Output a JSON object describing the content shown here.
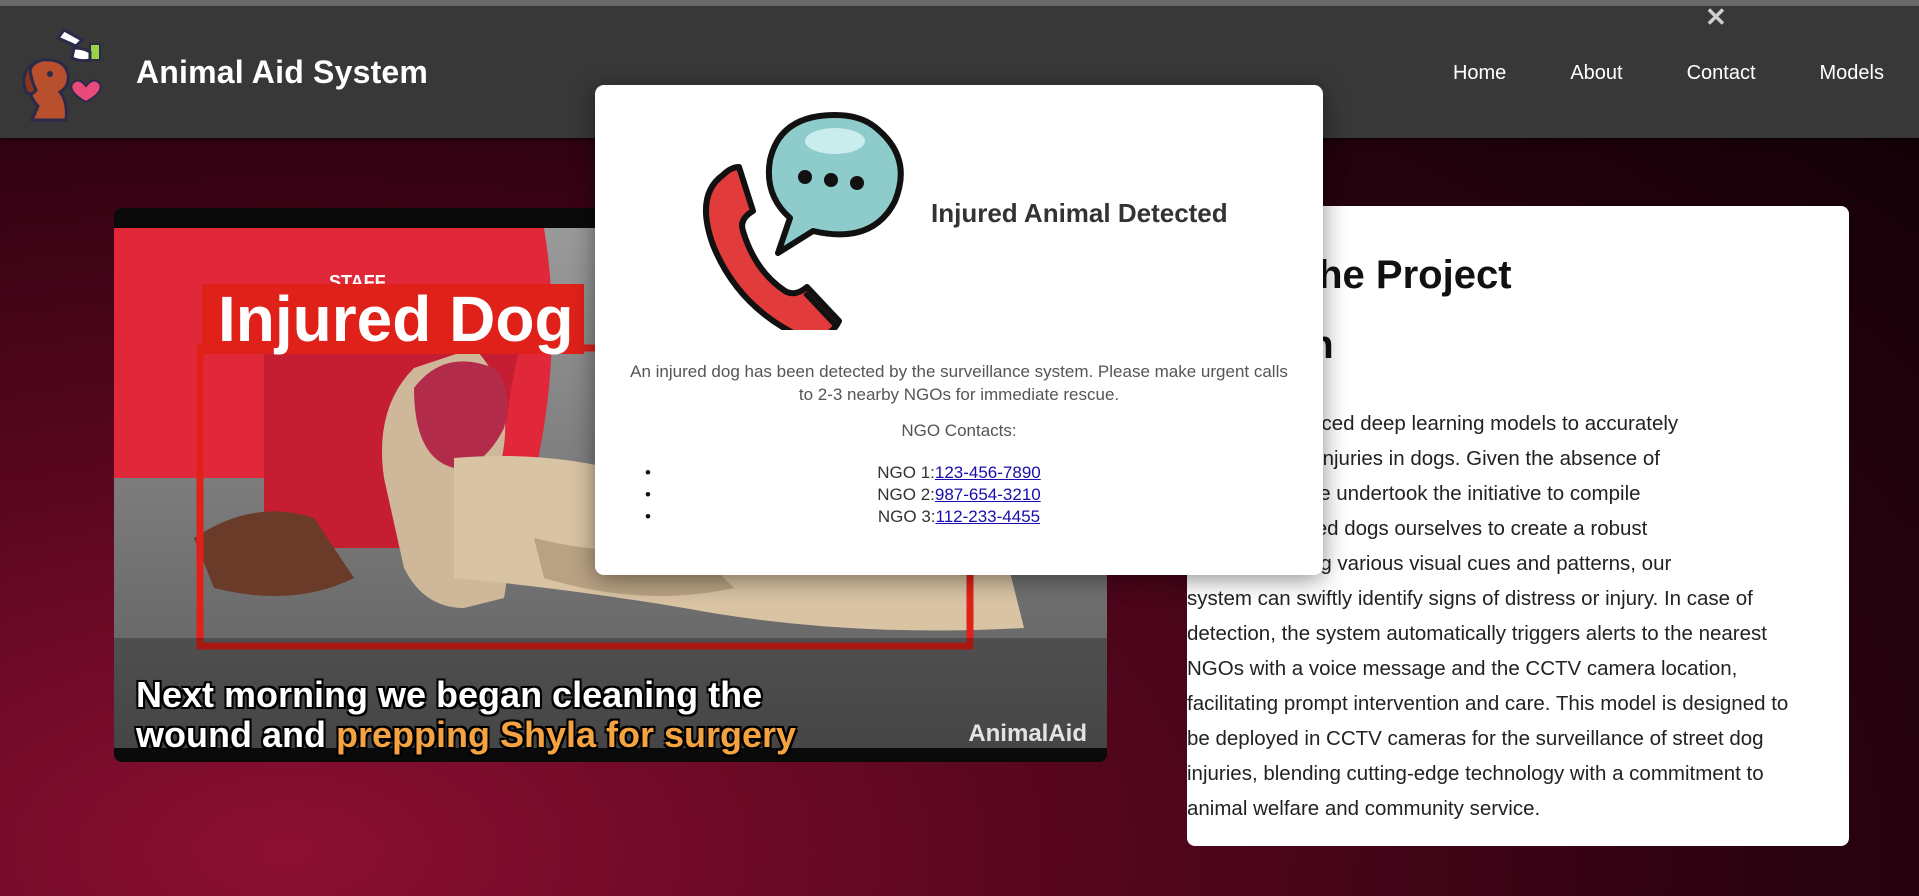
{
  "app": {
    "brand": "Animal Aid System",
    "logo_icon": "dog-care-logo-icon"
  },
  "nav": {
    "items": [
      "Home",
      "About",
      "Contact",
      "Models"
    ]
  },
  "close_label": "✕",
  "video": {
    "detection_label": "Injured Dog",
    "caption_line1": "Next morning we began cleaning the",
    "caption_line2_plain": "wound and ",
    "caption_line2_highlight": "prepping Shyla for surgery",
    "watermark": "AnimalAid",
    "shirt_text": "STAFF"
  },
  "info_card": {
    "title_line1": "me to the Project",
    "title_line2": "stration",
    "body_lines": [
      "verages advanced deep learning models to accurately",
      "sess potential injuries in dogs. Given the absence of",
      "ng datasets, we undertook the initiative to compile",
      "mages of injured dogs ourselves to create a robust",
      "et. By analyzing various visual cues and patterns, our",
      "system can swiftly identify signs of distress or injury. In case of",
      "detection, the system automatically triggers alerts to the nearest",
      "NGOs with a voice message and the CCTV camera location,",
      "facilitating prompt intervention and care. This model is designed to",
      "be deployed in CCTV cameras for the surveillance of street dog",
      "injuries, blending cutting-edge technology with a commitment to",
      "animal welfare and community service."
    ]
  },
  "alert_modal": {
    "icon": "phone-chat-icon",
    "title": "Injured Animal Detected",
    "message": "An injured dog has been detected by the surveillance system. Please make urgent calls to 2-3 nearby NGOs for immediate rescue.",
    "contacts_heading": "NGO Contacts:",
    "contacts": [
      {
        "label": "NGO 1:",
        "phone": "123-456-7890"
      },
      {
        "label": "NGO 2:",
        "phone": "987-654-3210"
      },
      {
        "label": "NGO 3:",
        "phone": "112-233-4455"
      }
    ]
  },
  "colors": {
    "header_bg": "#383838",
    "detection_red": "#e0211a",
    "link": "#1a0dab",
    "background_accent": "#8c0f33"
  }
}
